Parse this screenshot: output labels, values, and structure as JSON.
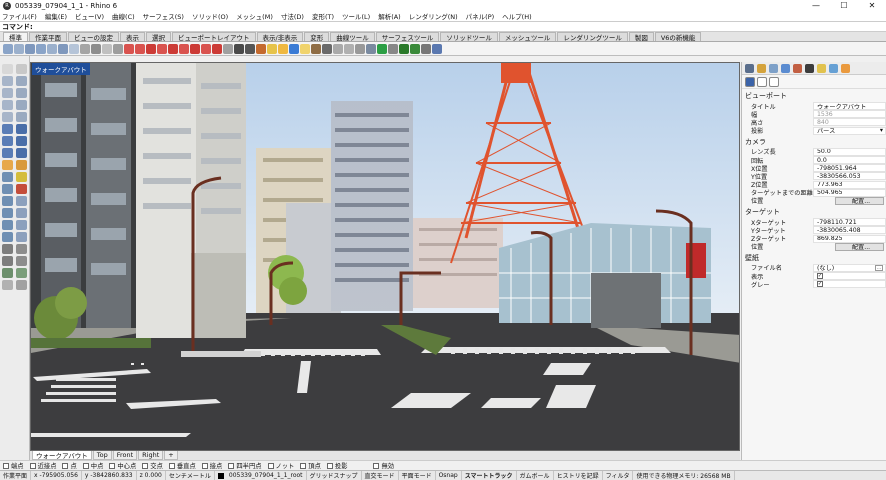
{
  "window": {
    "title": "005339_07904_1_1 - Rhino 6",
    "min": "—",
    "max": "☐",
    "close": "✕"
  },
  "menu": [
    "ファイル(F)",
    "編集(E)",
    "ビュー(V)",
    "曲線(C)",
    "サーフェス(S)",
    "ソリッド(O)",
    "メッシュ(M)",
    "寸法(D)",
    "変形(T)",
    "ツール(L)",
    "解析(A)",
    "レンダリング(N)",
    "パネル(P)",
    "ヘルプ(H)"
  ],
  "command": {
    "label": "コマンド:",
    "value": ""
  },
  "toolbar_tabs": [
    "標準",
    "作業平面",
    "ビューの設定",
    "表示",
    "選択",
    "ビューポートレイアウト",
    "表示/非表示",
    "変形",
    "曲線ツール",
    "サーフェスツール",
    "ソリッドツール",
    "メッシュツール",
    "レンダリングツール",
    "製図",
    "V6の新機能"
  ],
  "viewport": {
    "label": "ウォークアバウト"
  },
  "viewport_tabs": [
    "ウォークアバウト",
    "Top",
    "Front",
    "Right",
    "+"
  ],
  "osnaps": [
    "端点",
    "近接点",
    "点",
    "中点",
    "中心点",
    "交点",
    "垂直点",
    "接点",
    "四半円点",
    "ノット",
    "頂点",
    "投影",
    "無効"
  ],
  "status": {
    "plane": "作業平面",
    "x": "x -795905.056",
    "y": "y -3842860.833",
    "z": "z 0.000",
    "units": "センチメートル",
    "layer": "005339_07904_1_1_root",
    "items": [
      "グリッドスナップ",
      "直交モード",
      "平面モード",
      "Osnap",
      "スマートトラック",
      "ガムボール",
      "ヒストリを記録",
      "フィルタ"
    ],
    "memory": "使用できる物理メモリ: 26568 MB"
  },
  "panel": {
    "section_viewport": "ビューポート",
    "viewport_rows": [
      {
        "k": "タイトル",
        "v": "ウォークアバウト"
      },
      {
        "k": "幅",
        "v": "1536"
      },
      {
        "k": "高さ",
        "v": "840"
      },
      {
        "k": "投影",
        "v": "パース"
      }
    ],
    "section_camera": "カメラ",
    "camera_rows": [
      {
        "k": "レンズ長",
        "v": "50.0"
      },
      {
        "k": "回転",
        "v": "0.0"
      },
      {
        "k": "X位置",
        "v": "-798051.964"
      },
      {
        "k": "Y位置",
        "v": "-3830566.053"
      },
      {
        "k": "Z位置",
        "v": "773.963"
      },
      {
        "k": "ターゲットまでの距離",
        "v": "504.965"
      },
      {
        "k": "位置",
        "v": "配置..."
      }
    ],
    "section_target": "ターゲット",
    "target_rows": [
      {
        "k": "Xターゲット",
        "v": "-798110.721"
      },
      {
        "k": "Yターゲット",
        "v": "-3830065.408"
      },
      {
        "k": "Zターゲット",
        "v": "869.825"
      },
      {
        "k": "位置",
        "v": "配置..."
      }
    ],
    "section_wallpaper": "壁紙",
    "wallpaper_rows": [
      {
        "k": "ファイル名",
        "v": "(なし)"
      },
      {
        "k": "表示",
        "v": "✓"
      },
      {
        "k": "グレー",
        "v": "✓"
      }
    ]
  },
  "colors": {
    "accent": "#1f4e9a",
    "sky": "#c9dcef",
    "tower": "#e0532e",
    "road": "#3d3d3f"
  }
}
